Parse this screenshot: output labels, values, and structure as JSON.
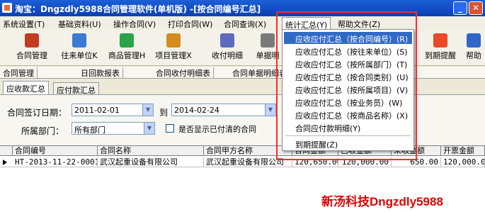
{
  "window": {
    "title": "淘宝：Dngzdly5988合同管理软件(单机版)     -[按合同编号汇总]",
    "minimize_label": "_",
    "close_label": "✕"
  },
  "menubar": {
    "items": [
      "系统设置(T)",
      "基础资料(U)",
      "操作合同(V)",
      "打印合同(W)",
      "合同查询(X)",
      "统计汇总(Y)",
      "帮助文件(Z)"
    ]
  },
  "toolbar": {
    "buttons": [
      {
        "label": "合同管理",
        "icon": "contract-manage-icon",
        "color": "#c23b22"
      },
      {
        "label": "往来单位K",
        "icon": "partner-unit-icon",
        "color": "#3a7bd5"
      },
      {
        "label": "商品管理H",
        "icon": "goods-manage-icon",
        "color": "#2aa34a"
      },
      {
        "label": "项目管理X",
        "icon": "project-manage-icon",
        "color": "#d68b1e"
      },
      {
        "label": "收付明细",
        "icon": "payment-detail-icon",
        "color": "#5c6bc0"
      },
      {
        "label": "单据明",
        "icon": "document-detail-icon",
        "color": "#7a7a7a"
      },
      {
        "label": "到期提醒",
        "icon": "expiry-reminder-icon",
        "color": "#e84a2a"
      },
      {
        "label": "帮助",
        "icon": "help-icon",
        "color": "#2f67c9"
      }
    ]
  },
  "navtabs": {
    "items": [
      "合同管理",
      "日回款报表",
      "合同收付明细表",
      "合同单据明细表"
    ]
  },
  "subtabs": {
    "items": [
      "应收款汇总",
      "应付款汇总"
    ]
  },
  "filter": {
    "date_label": "合同签订日期：",
    "date_from": "2011-02-01",
    "to_label": "到",
    "date_to": "2014-02-24",
    "dept_label": "所属部门：",
    "dept_value": "所有部门",
    "show_paid_label": "是否显示已付清的合同"
  },
  "grid": {
    "columns": [
      "合同编号",
      "合同名称",
      "合同甲方名称",
      "合同金额",
      "已收金额",
      "未收金额",
      "开票金额"
    ],
    "rows": [
      [
        "HT-2013-11-22-0001",
        "武汉起重设备有限公司",
        "武汉起重设备有限公司",
        "120,650.00",
        "120,000.00",
        "650.00",
        "120,000.00"
      ]
    ]
  },
  "dropdown": {
    "items": [
      "应收应付汇总（按合同编号）(R)",
      "应收应付汇总（按往来单位）(S)",
      "应收应付汇总（按所属部门）(T)",
      "应收应付汇总（按合同类别）(U)",
      "应收应付汇总（按所属项目）(V)",
      "应收应付汇总（按业务员）(W)",
      "应收应付汇总（按商品名称）(X)",
      "合同应付款明细(Y)",
      "到期提醒(Z)"
    ]
  },
  "watermark": "新汤科技Dngzdly5988",
  "colors": {
    "titlebar": "#0a3fb4",
    "highlight": "#316ac5",
    "frame": "#ff2a2a",
    "watermark": "#e00000"
  }
}
